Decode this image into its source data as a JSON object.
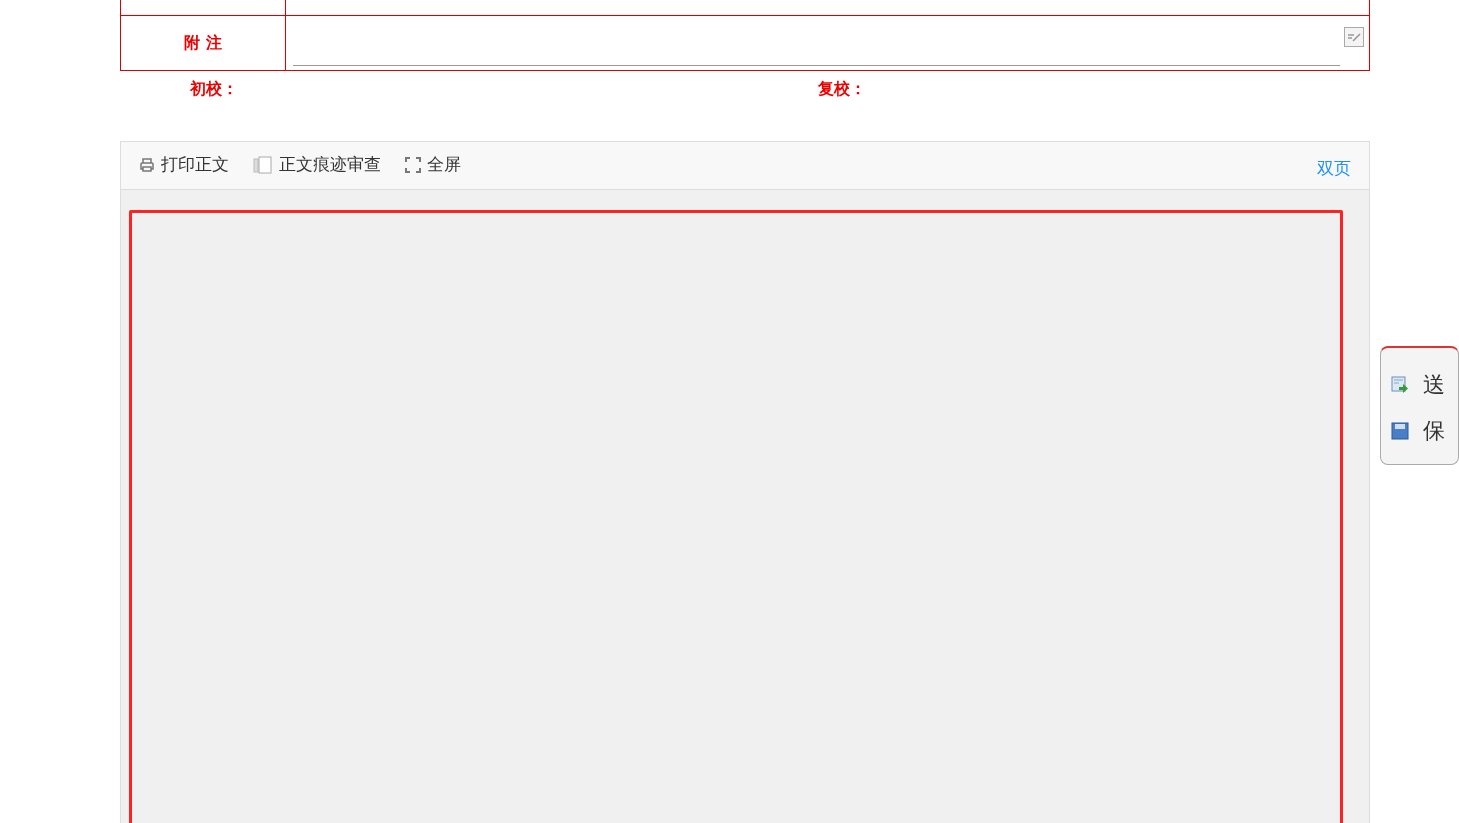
{
  "form": {
    "note_label": "附 注"
  },
  "signatures": [
    {
      "label": "初校："
    },
    {
      "label": "复校："
    }
  ],
  "toolbar": {
    "buttons": [
      {
        "label": "打印正文"
      },
      {
        "label": "正文痕迹审查"
      },
      {
        "label": "全屏"
      }
    ],
    "view_mode": "双页"
  },
  "side_menu": {
    "items": [
      {
        "label": "送"
      },
      {
        "label": "保"
      }
    ]
  }
}
